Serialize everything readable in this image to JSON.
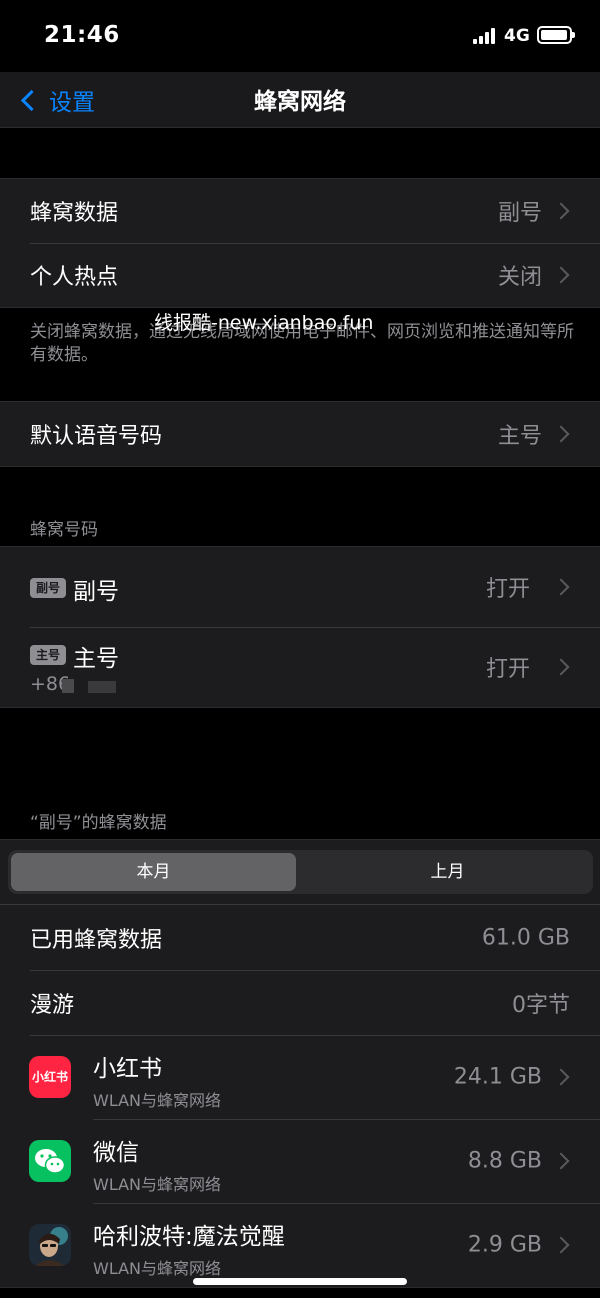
{
  "status_bar": {
    "time": "21:46",
    "network": "4G"
  },
  "nav": {
    "back_label": "设置",
    "title": "蜂窝网络"
  },
  "watermark": "线报酷-new.xianbao.fun",
  "group1": {
    "rows": [
      {
        "label": "蜂窝数据",
        "value": "副号"
      },
      {
        "label": "个人热点",
        "value": "关闭"
      }
    ],
    "footer": "关闭蜂窝数据，通过无线局域网使用电子邮件、网页浏览和推送通知等所有数据。"
  },
  "group2": {
    "label": "默认语音号码",
    "value": "主号"
  },
  "sim_section": {
    "header": "蜂窝号码",
    "rows": [
      {
        "badge": "副号",
        "name": "副号",
        "value": "打开"
      },
      {
        "badge": "主号",
        "name": "主号",
        "number": "+86",
        "value": "打开"
      }
    ]
  },
  "usage_section": {
    "header": "“副号”的蜂窝数据",
    "segments": [
      "本月",
      "上月"
    ],
    "rows": [
      {
        "label": "已用蜂窝数据",
        "value": "61.0 GB"
      },
      {
        "label": "漫游",
        "value": "0字节"
      }
    ],
    "apps": [
      {
        "name": "小红书",
        "icon_text": "小红书",
        "icon": "xiaohongshu-icon",
        "sub": "WLAN与蜂窝网络",
        "value": "24.1 GB"
      },
      {
        "name": "微信",
        "icon": "wechat-icon",
        "sub": "WLAN与蜂窝网络",
        "value": "8.8 GB"
      },
      {
        "name": "哈利波特:魔法觉醒",
        "icon": "harry-potter-game-icon",
        "sub": "WLAN与蜂窝网络",
        "value": "2.9 GB"
      }
    ]
  },
  "colors": {
    "accent": "#0a84ff",
    "background": "#000000",
    "cell": "#1c1c1e",
    "secondary_text": "#8e8e93"
  }
}
